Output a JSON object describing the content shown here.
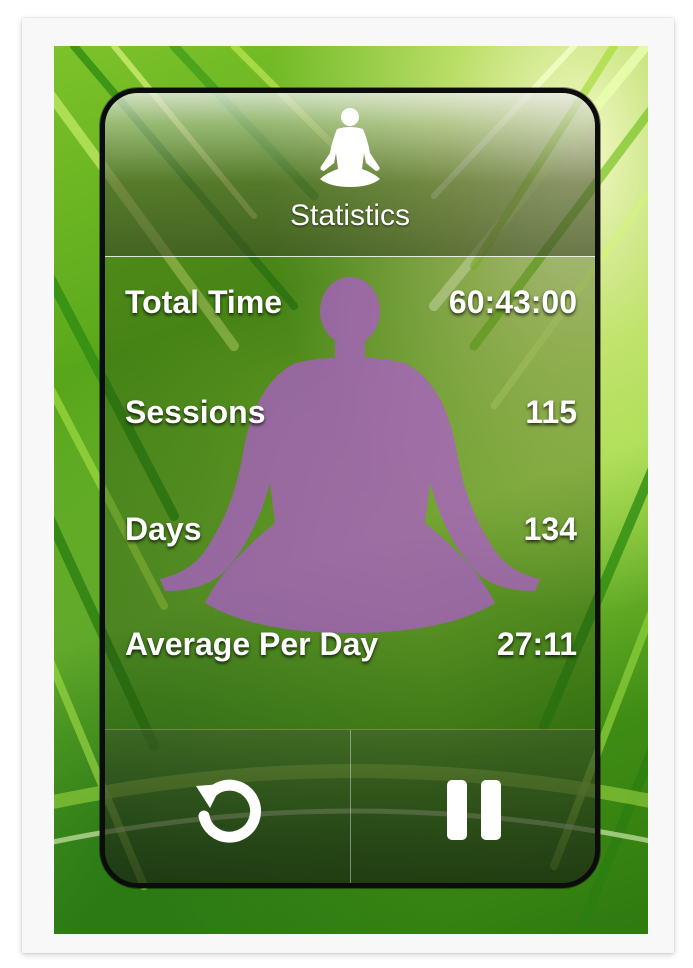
{
  "panel": {
    "title": "Statistics"
  },
  "stats": [
    {
      "label": "Total Time",
      "value": "60:43:00"
    },
    {
      "label": "Sessions",
      "value": "115"
    },
    {
      "label": "Days",
      "value": "134"
    },
    {
      "label": "Average Per Day",
      "value": "27:11"
    }
  ],
  "icons": {
    "header": "meditation-figure-icon",
    "background_figure": "meditation-silhouette",
    "reset": "reset-icon",
    "pause": "pause-icon"
  },
  "colors": {
    "figure": "#b05ad0",
    "text": "#ffffff",
    "frame": "#0c0c0c",
    "leaf": "#5aa81b"
  }
}
